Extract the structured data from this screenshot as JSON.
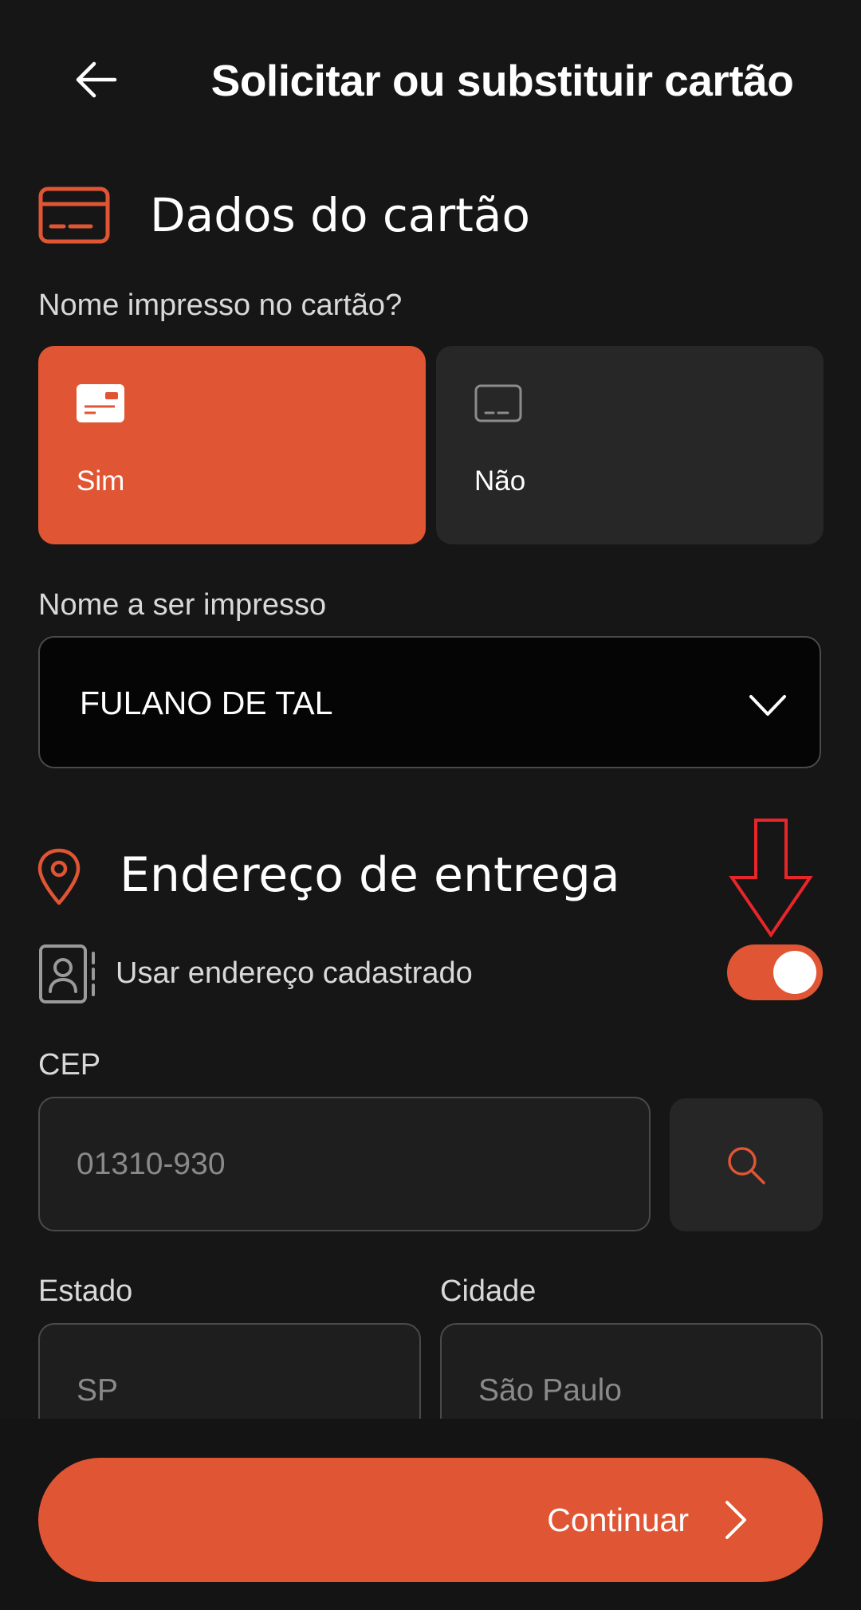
{
  "header": {
    "title": "Solicitar ou substituir cartão"
  },
  "card_section": {
    "title": "Dados do cartão",
    "question": "Nome impresso no cartão?",
    "options": [
      {
        "label": "Sim",
        "selected": true
      },
      {
        "label": "Não",
        "selected": false
      }
    ],
    "print_name_label": "Nome a ser impresso",
    "print_name_value": "FULANO DE TAL"
  },
  "address_section": {
    "title": "Endereço de entrega",
    "use_registered_label": "Usar endereço cadastrado",
    "use_registered_enabled": true,
    "cep_label": "CEP",
    "cep_placeholder": "01310-930",
    "state_label": "Estado",
    "state_placeholder": "SP",
    "city_label": "Cidade",
    "city_placeholder": "São Paulo"
  },
  "footer": {
    "continue_label": "Continuar"
  },
  "colors": {
    "background": "#161616",
    "accent": "#e05533",
    "annotation_arrow": "#e8262a"
  },
  "icons": {
    "back": "arrow-left-icon",
    "card": "credit-card-icon",
    "location": "map-pin-icon",
    "contact": "contact-book-icon",
    "search": "search-icon",
    "chevron": "chevron-down-icon",
    "continue": "chevron-right-icon"
  }
}
